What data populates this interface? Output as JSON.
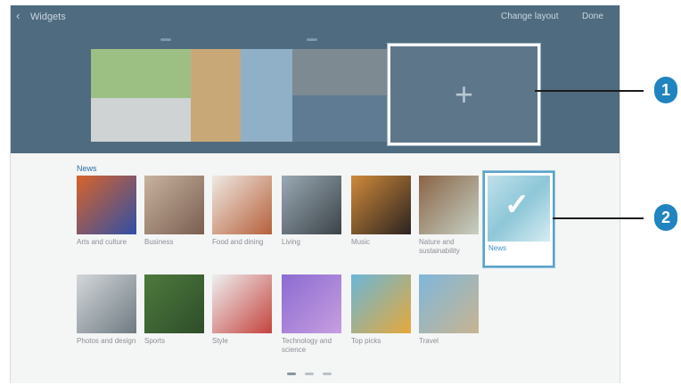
{
  "header": {
    "back_glyph": "‹",
    "title": "Widgets",
    "change_layout": "Change layout",
    "done": "Done"
  },
  "add_panel": {
    "glyph": "+"
  },
  "section_label": "News",
  "row1": [
    {
      "label": "Arts and culture",
      "color1": "#d8632a",
      "color2": "#2f4fa6"
    },
    {
      "label": "Business",
      "color1": "#c8b39f",
      "color2": "#7a5e50"
    },
    {
      "label": "Food and dining",
      "color1": "#efe9e2",
      "color2": "#b6603b"
    },
    {
      "label": "Living",
      "color1": "#9aaab4",
      "color2": "#3b4348"
    },
    {
      "label": "Music",
      "color1": "#cf8a3a",
      "color2": "#2b2320"
    },
    {
      "label": "Nature and sustainability",
      "color1": "#8a6446",
      "color2": "#c5d0c3"
    }
  ],
  "selected_tile": {
    "label": "News",
    "check": "✓"
  },
  "row2": [
    {
      "label": "Photos and design",
      "color1": "#d3d7da",
      "color2": "#6f7b82"
    },
    {
      "label": "Sports",
      "color1": "#4d7a3c",
      "color2": "#2e4d2a"
    },
    {
      "label": "Style",
      "color1": "#eef0f1",
      "color2": "#c5433d"
    },
    {
      "label": "Technology and science",
      "color1": "#8b6bd1",
      "color2": "#c79ee0"
    },
    {
      "label": "Top picks",
      "color1": "#6ab7d8",
      "color2": "#e6a83a"
    },
    {
      "label": "Travel",
      "color1": "#7fb7db",
      "color2": "#c8b491"
    }
  ],
  "callouts": [
    "1",
    "2"
  ]
}
